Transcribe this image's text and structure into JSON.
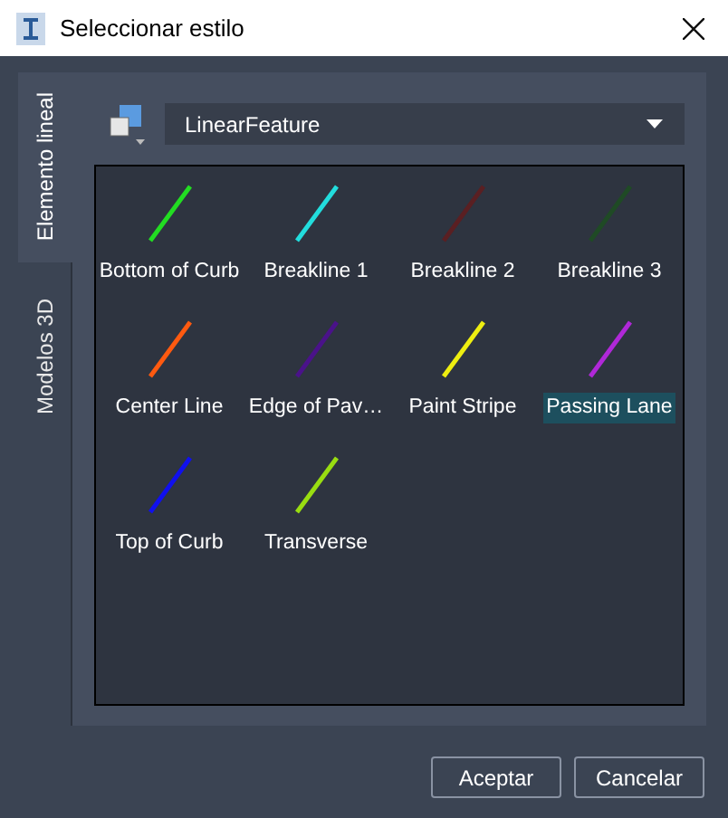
{
  "window": {
    "title": "Seleccionar estilo"
  },
  "tabs": [
    {
      "label": "Elemento lineal",
      "selected": true
    },
    {
      "label": "Modelos 3D",
      "selected": false
    }
  ],
  "style_dropdown": {
    "value": "LinearFeature"
  },
  "styles": [
    {
      "name": "Bottom of Curb",
      "color": "#22dd22",
      "selected": false
    },
    {
      "name": "Breakline 1",
      "color": "#22dddd",
      "selected": false
    },
    {
      "name": "Breakline 2",
      "color": "#5a1f22",
      "selected": false
    },
    {
      "name": "Breakline 3",
      "color": "#1f4a25",
      "selected": false
    },
    {
      "name": "Center Line",
      "color": "#ff5a10",
      "selected": false
    },
    {
      "name": "Edge of Pav…",
      "color": "#4a128a",
      "selected": false
    },
    {
      "name": "Paint Stripe",
      "color": "#eeee11",
      "selected": false
    },
    {
      "name": "Passing Lane",
      "color": "#b028d8",
      "selected": true
    },
    {
      "name": "Top of Curb",
      "color": "#1010ee",
      "selected": false
    },
    {
      "name": "Transverse",
      "color": "#99dd11",
      "selected": false
    }
  ],
  "buttons": [
    "Aceptar",
    "Cancelar"
  ]
}
